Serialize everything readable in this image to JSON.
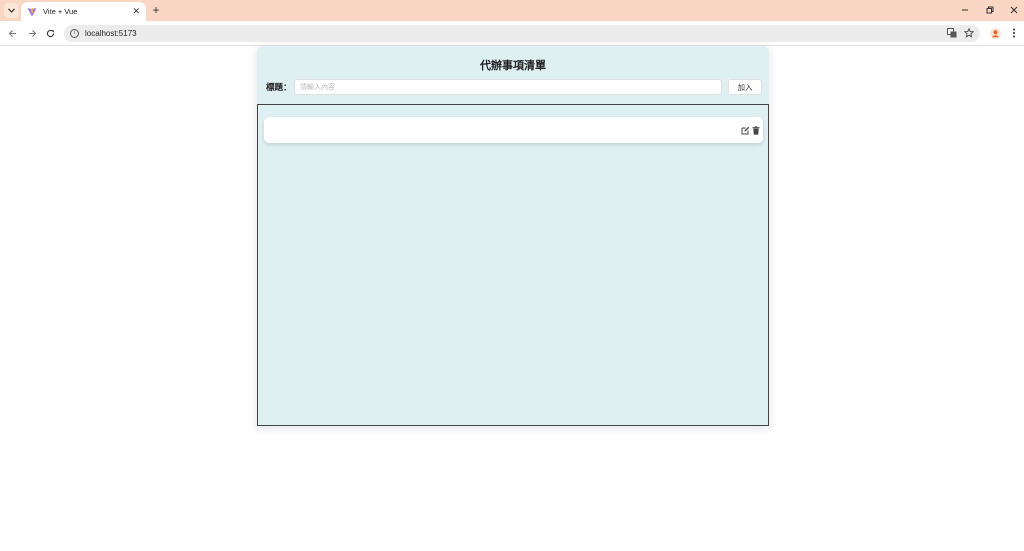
{
  "browser": {
    "tab_title": "Vite + Vue",
    "url": "localhost:5173"
  },
  "app": {
    "title": "代辦事項清單",
    "form": {
      "label": "標題：",
      "input_value": "",
      "input_placeholder": "請輸入內容",
      "add_label": "加入"
    },
    "todos": [
      {
        "text": ""
      }
    ]
  },
  "colors": {
    "tabbar": "#fad6c4",
    "card_bg": "#dff0f2"
  }
}
